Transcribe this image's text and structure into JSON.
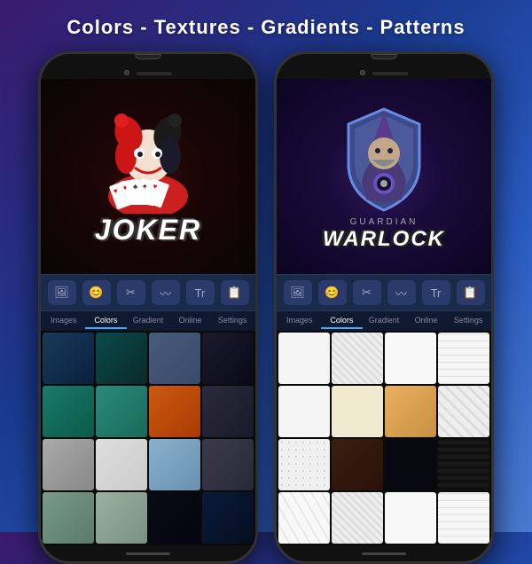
{
  "header": {
    "title": "Colors - Textures - Gradients - Patterns"
  },
  "phone_left": {
    "game_name": "JOKER",
    "tabs": [
      {
        "label": "Images",
        "active": false
      },
      {
        "label": "Colors",
        "active": true
      },
      {
        "label": "Gradient",
        "active": false
      },
      {
        "label": "Online",
        "active": false
      },
      {
        "label": "Settings",
        "active": false
      }
    ],
    "toolbar_icons": [
      "🖼",
      "😊",
      "✂",
      "〰",
      "Tr",
      "📋"
    ]
  },
  "phone_right": {
    "game_name": "WARLOCK",
    "subtitle": "GUARDIAN",
    "tabs": [
      {
        "label": "Images",
        "active": false
      },
      {
        "label": "Colors",
        "active": true
      },
      {
        "label": "Gradient",
        "active": false
      },
      {
        "label": "Online",
        "active": false
      },
      {
        "label": "Settings",
        "active": false
      }
    ],
    "toolbar_icons": [
      "🖼",
      "😊",
      "✂",
      "〰",
      "Tr",
      "📋"
    ]
  }
}
